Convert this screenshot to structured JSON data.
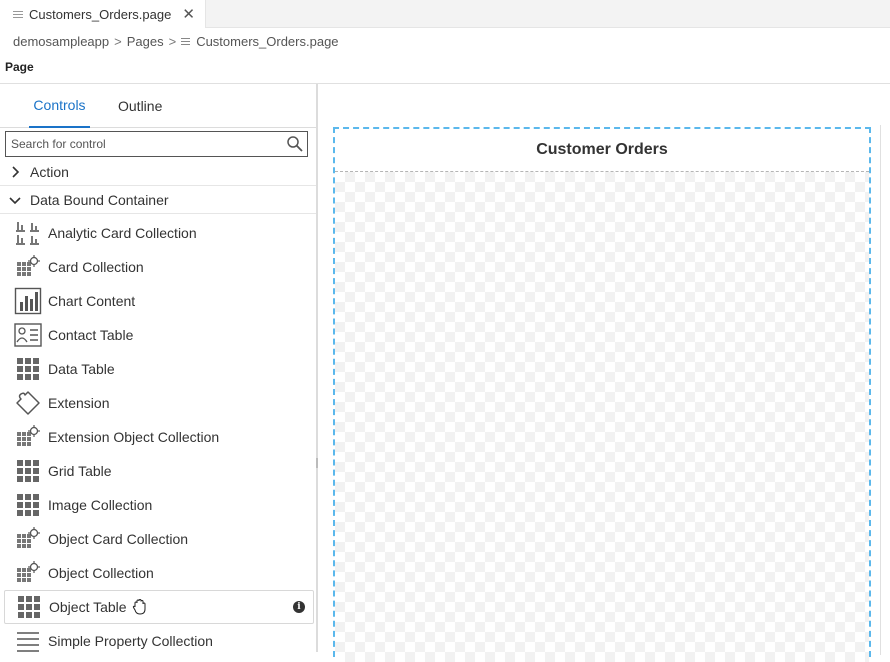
{
  "tabbar": {
    "file_tab": "Customers_Orders.page",
    "close_glyph": "✕"
  },
  "breadcrumb": {
    "app": "demosampleapp",
    "folder": "Pages",
    "file": "Customers_Orders.page",
    "separator": ">"
  },
  "editor": {
    "section_label": "Page"
  },
  "palette": {
    "tabs": [
      {
        "label": "Controls",
        "active": true
      },
      {
        "label": "Outline",
        "active": false
      }
    ],
    "search_placeholder": "Search for control",
    "categories": [
      {
        "label": "Action",
        "expanded": false
      },
      {
        "label": "Data Bound Container",
        "expanded": true
      }
    ],
    "items": [
      {
        "label": "Analytic Card Collection",
        "icon": "analytic-card-icon"
      },
      {
        "label": "Card Collection",
        "icon": "card-collection-icon"
      },
      {
        "label": "Chart Content",
        "icon": "chart-icon"
      },
      {
        "label": "Contact Table",
        "icon": "contact-card-icon"
      },
      {
        "label": "Data Table",
        "icon": "grid-icon"
      },
      {
        "label": "Extension",
        "icon": "puzzle-icon"
      },
      {
        "label": "Extension Object Collection",
        "icon": "grid-gear-icon"
      },
      {
        "label": "Grid Table",
        "icon": "grid-icon"
      },
      {
        "label": "Image Collection",
        "icon": "grid-icon"
      },
      {
        "label": "Object Card Collection",
        "icon": "grid-gear-icon"
      },
      {
        "label": "Object Collection",
        "icon": "grid-gear-icon"
      },
      {
        "label": "Object Table",
        "icon": "grid-icon"
      },
      {
        "label": "Simple Property Collection",
        "icon": "list-icon"
      }
    ],
    "info_glyph": "i"
  },
  "canvas": {
    "page_title": "Customer Orders"
  },
  "colors": {
    "accent": "#1a73c8",
    "selection": "#5bb8ec"
  }
}
